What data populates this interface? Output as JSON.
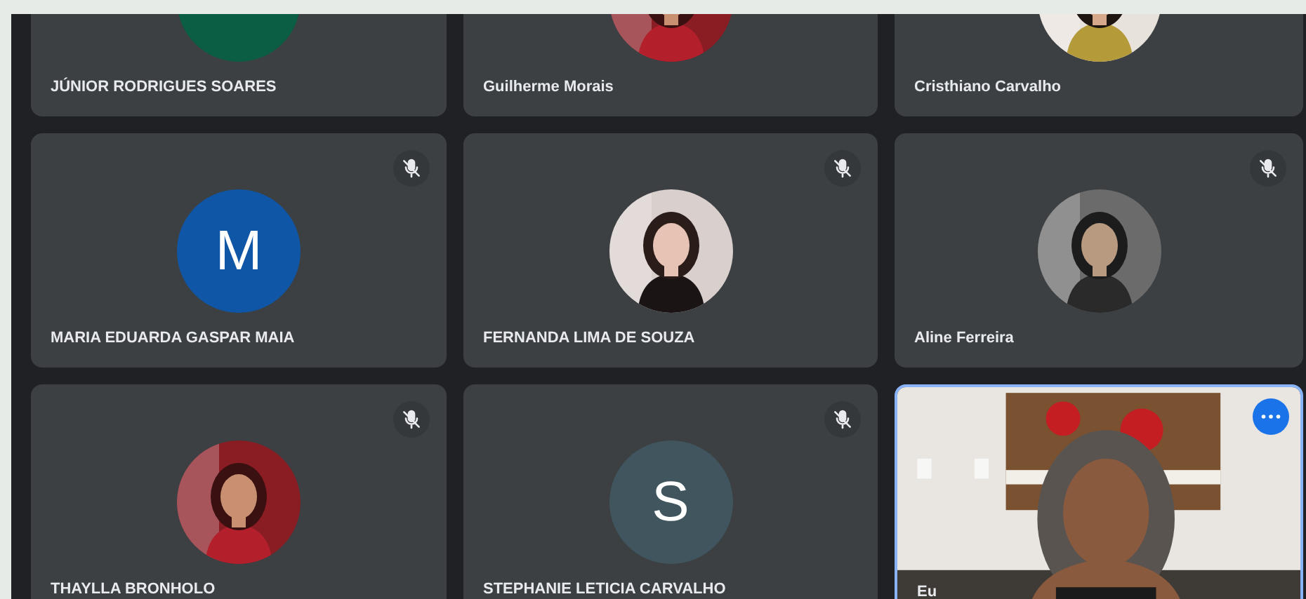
{
  "tiles": [
    {
      "kind": "letter",
      "color": "#0b5d43",
      "name": "JÚNIOR RODRIGUES SOARES",
      "selected": false
    },
    {
      "name": "Guilherme Morais",
      "selected": false
    },
    {
      "name": "Cristhiano Carvalho",
      "selected": false
    },
    {
      "kind": "letter",
      "letter": "M",
      "color": "#0f56a6",
      "name": "MARIA EDUARDA GASPAR MAIA",
      "muted": true,
      "selected": false
    },
    {
      "name": "FERNANDA LIMA DE SOUZA",
      "muted": true,
      "selected": false
    },
    {
      "name": "Aline Ferreira",
      "muted": true,
      "selected": false
    },
    {
      "name": "THAYLLA BRONHOLO",
      "muted": true,
      "selected": false
    },
    {
      "kind": "letter",
      "letter": "S",
      "color": "#41555f",
      "name": "STEPHANIE LETICIA CARVALHO",
      "muted": true,
      "selected": false
    },
    {
      "kind": "video",
      "name": "Eu",
      "selected": true
    }
  ]
}
